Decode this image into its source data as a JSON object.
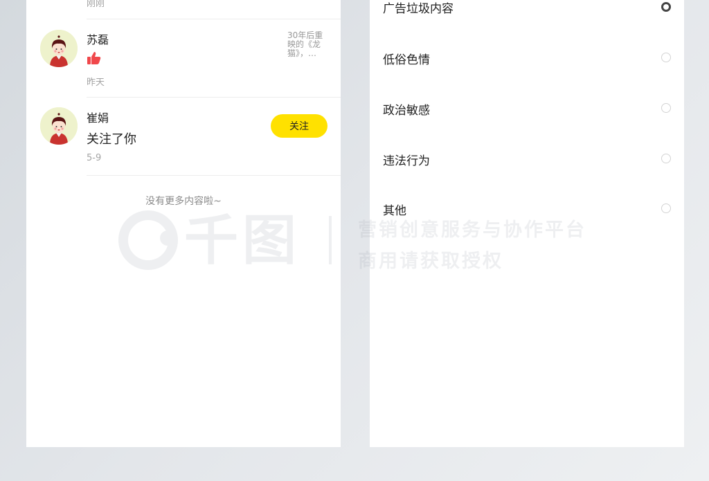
{
  "left": {
    "top_time": "刚刚",
    "items": [
      {
        "name": "苏磊",
        "snippet": "30年后重映的《龙猫》，…",
        "time": "昨天"
      },
      {
        "name": "崔娟",
        "message": "关注了你",
        "time": "5-9",
        "button": "关注"
      }
    ],
    "no_more": "没有更多内容啦~"
  },
  "right": {
    "options": [
      {
        "label": "广告垃圾内容",
        "selected": true
      },
      {
        "label": "低俗色情",
        "selected": false
      },
      {
        "label": "政治敏感",
        "selected": false
      },
      {
        "label": "违法行为",
        "selected": false
      },
      {
        "label": "其他",
        "selected": false
      }
    ]
  },
  "watermark": {
    "logo": "千图",
    "line1": "营销创意服务与协作平台",
    "line2": "商用请获取授权"
  },
  "colors": {
    "accent": "#ffe100",
    "like": "#f0474b",
    "avatar_bg": "#eef2cc",
    "shirt": "#c9332f",
    "hair": "#5a1414"
  }
}
